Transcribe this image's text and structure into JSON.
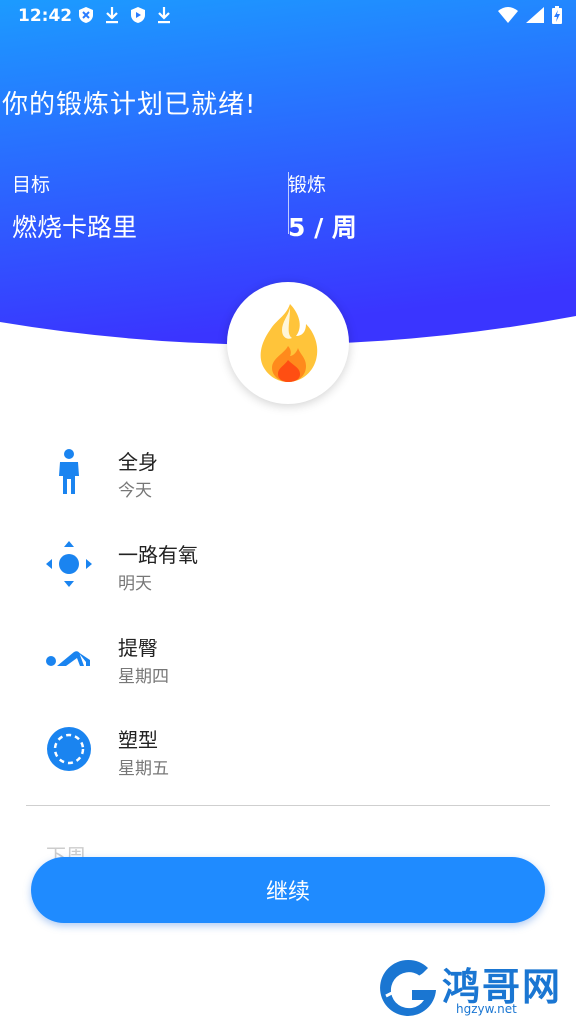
{
  "status_bar": {
    "time": "12:42",
    "left_icons": [
      "shield-x-icon",
      "download-icon",
      "play-protect-icon",
      "download-icon"
    ],
    "right_icons": [
      "wifi-icon",
      "signal-icon",
      "battery-charging-icon"
    ]
  },
  "header": {
    "headline": "你的锻炼计划已就绪!",
    "goal_label": "目标",
    "goal_value": "燃烧卡路里",
    "frequency_label": "锻炼",
    "frequency_value": "5 / 周",
    "gradient_colors": [
      "#1c9bff",
      "#3a35ff"
    ]
  },
  "plan": [
    {
      "icon": "person-standing-icon",
      "title": "全身",
      "day": "今天"
    },
    {
      "icon": "aerobic-arrows-icon",
      "title": "一路有氧",
      "day": "明天"
    },
    {
      "icon": "glute-bridge-icon",
      "title": "提臀",
      "day": "星期四"
    },
    {
      "icon": "shape-circle-icon",
      "title": "塑型",
      "day": "星期五"
    }
  ],
  "next_week_label": "下周",
  "continue_button": "继续",
  "watermark": {
    "title": "鸿哥网",
    "url": "hgzyw.net"
  },
  "colors": {
    "accent": "#1f8bff",
    "icon_blue": "#1a84f0"
  }
}
